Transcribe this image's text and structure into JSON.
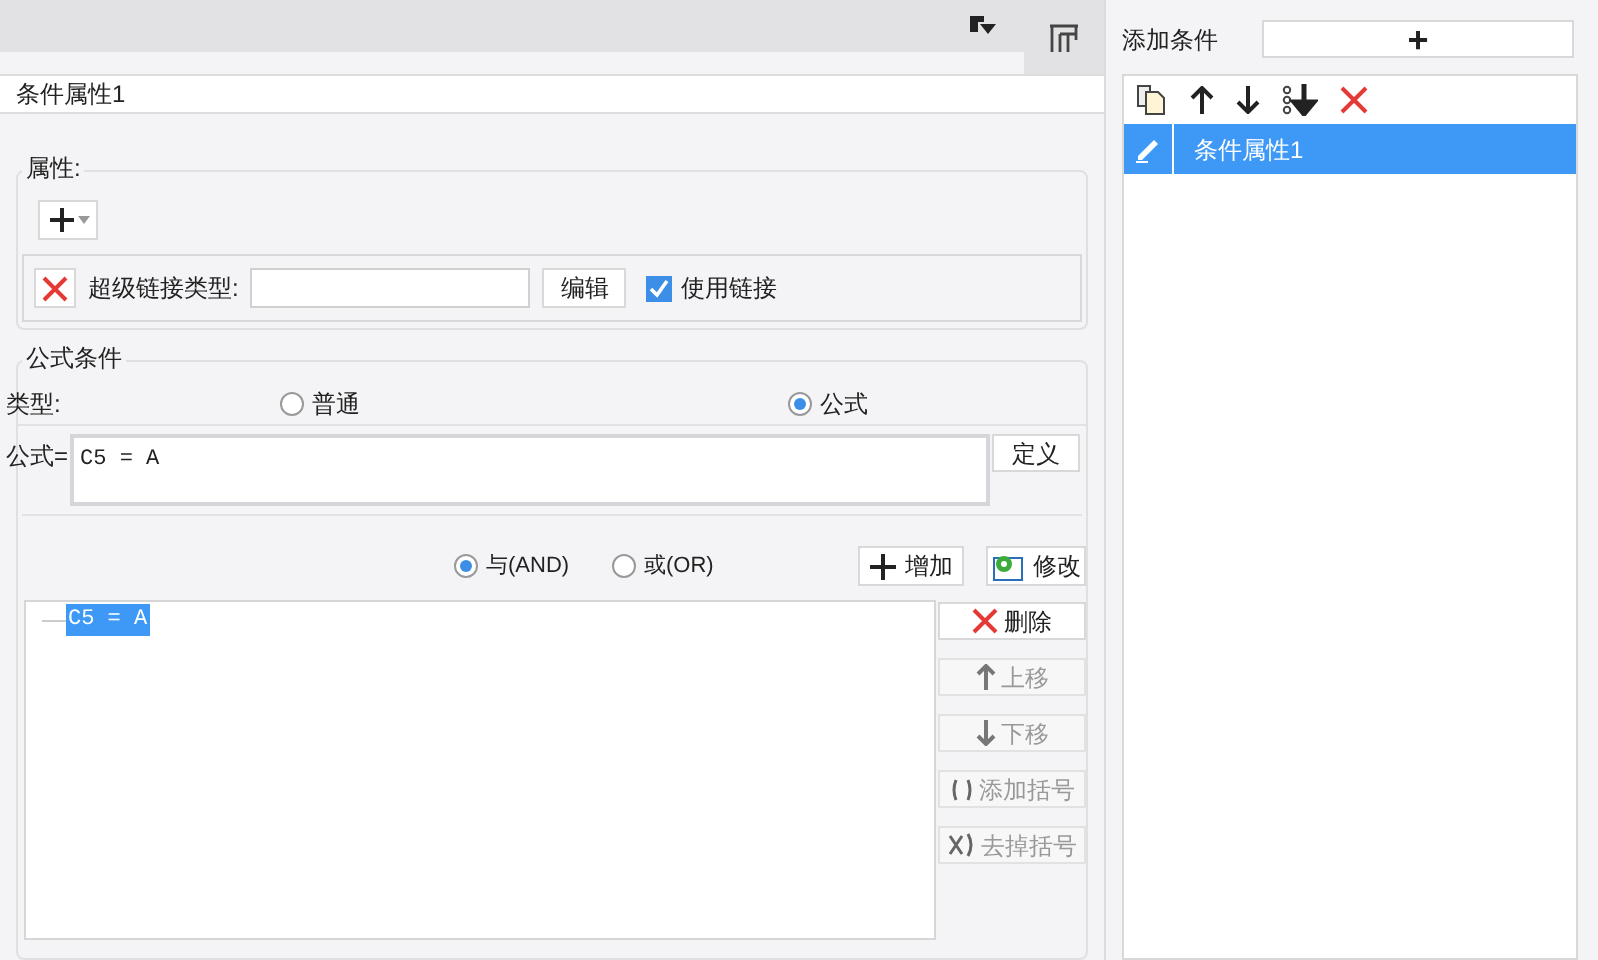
{
  "editor": {
    "title": "条件属性1",
    "attributes": {
      "legend": "属性:",
      "hyperlink_label": "超级链接类型:",
      "edit_button": "编辑",
      "use_link": {
        "label": "使用链接",
        "checked": true
      }
    },
    "formula_condition": {
      "legend": "公式条件",
      "type_label": "类型:",
      "types": [
        {
          "label": "普通",
          "selected": false
        },
        {
          "label": "公式",
          "selected": true
        }
      ],
      "formula_label": "公式=",
      "formula_value": "C5 = A",
      "define_button": "定义",
      "operators": [
        {
          "label": "与(AND)",
          "selected": true
        },
        {
          "label": "或(OR)",
          "selected": false
        }
      ],
      "actions": [
        {
          "label": "增加",
          "kind": "add"
        },
        {
          "label": "修改",
          "kind": "modify"
        }
      ],
      "conditions": [
        {
          "text": "C5 = A",
          "selected": true
        }
      ],
      "side_buttons": [
        {
          "label": "删除",
          "kind": "delete",
          "disabled": false
        },
        {
          "label": "上移",
          "kind": "up",
          "disabled": true
        },
        {
          "label": "下移",
          "kind": "down",
          "disabled": true
        },
        {
          "label": "添加括号",
          "kind": "add-paren",
          "disabled": true
        },
        {
          "label": "去掉括号",
          "kind": "remove-paren",
          "disabled": true
        }
      ]
    }
  },
  "sidebar": {
    "add_label": "添加条件",
    "add_button": "+",
    "items": [
      {
        "label": "条件属性1",
        "selected": true
      }
    ]
  }
}
